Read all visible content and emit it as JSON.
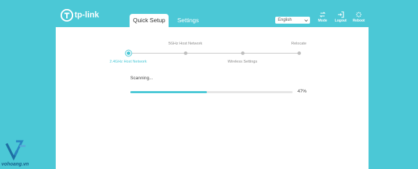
{
  "header": {
    "brand": "tp-link",
    "tabs": [
      {
        "label": "Quick Setup",
        "active": true
      },
      {
        "label": "Settings",
        "active": false
      }
    ],
    "language": {
      "selected": "English"
    },
    "tools": [
      {
        "label": "Mode",
        "icon": "mode-icon"
      },
      {
        "label": "Logout",
        "icon": "logout-icon"
      },
      {
        "label": "Reboot",
        "icon": "reboot-icon"
      }
    ]
  },
  "wizard": {
    "steps": [
      {
        "label": "2.4GHz Host Network",
        "active": true
      },
      {
        "label": "5GHz Host Network",
        "active": false
      },
      {
        "label": "Wireless Settings",
        "active": false
      },
      {
        "label": "Relocate",
        "active": false
      }
    ]
  },
  "scan": {
    "status": "Scanning...",
    "progress": 47,
    "progress_text": "47%"
  },
  "watermark": {
    "text": "vohoang.vn"
  },
  "colors": {
    "accent": "#4bc8d6",
    "panel": "#ffffff",
    "watermark": "#155f8a"
  }
}
